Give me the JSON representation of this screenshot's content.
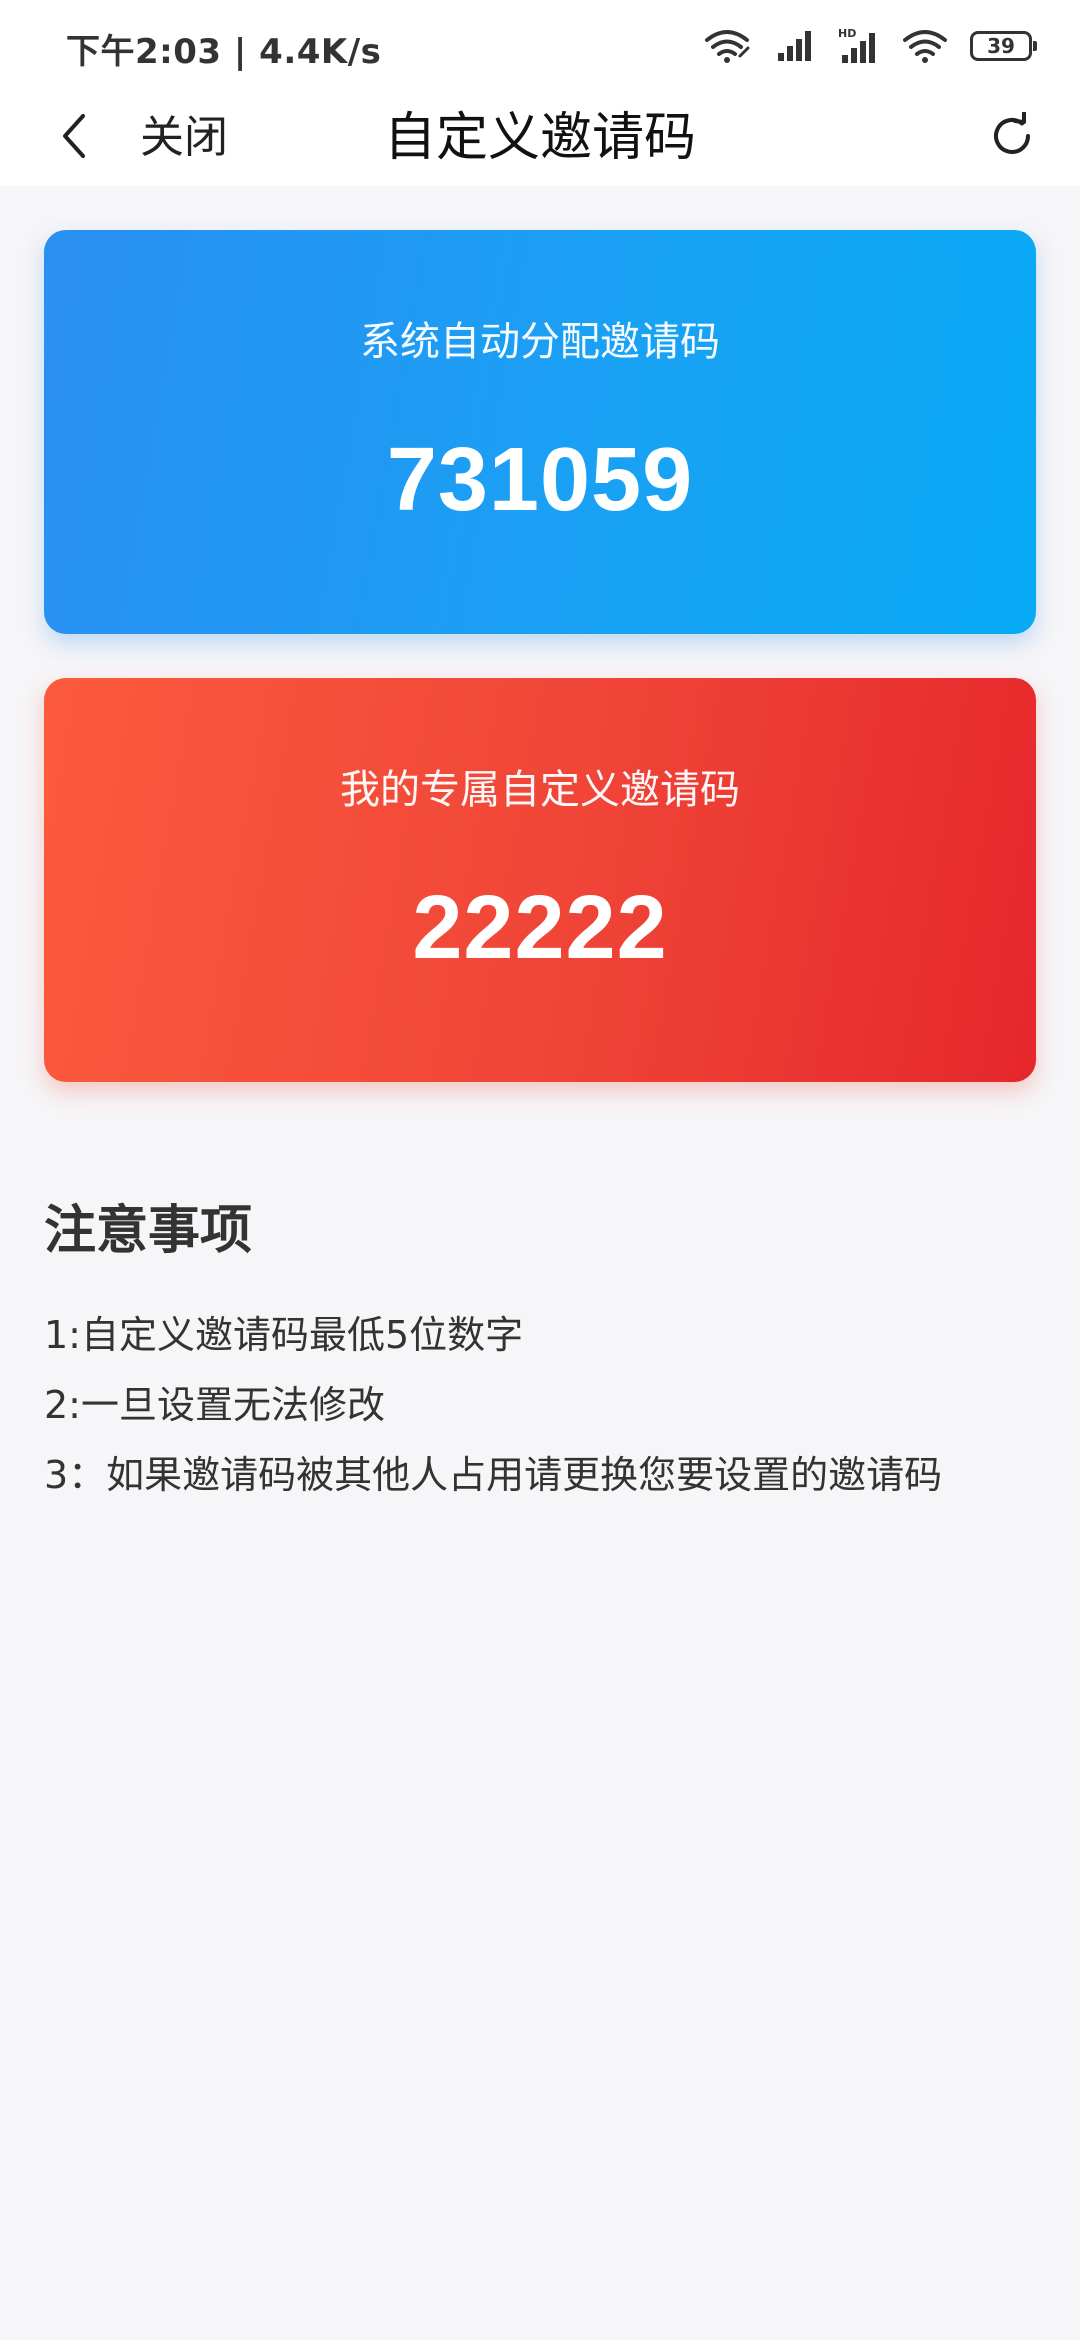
{
  "status_bar": {
    "time": "下午2:03 | 4.4K/s",
    "battery": "39"
  },
  "nav": {
    "close_label": "关闭",
    "title": "自定义邀请码",
    "icons": [
      "chevron-left-icon",
      "refresh-icon"
    ]
  },
  "system_card": {
    "label": "系统自动分配邀请码",
    "code": "731059",
    "color": "#1ea0f4"
  },
  "custom_card": {
    "label": "我的专属自定义邀请码",
    "code": "22222",
    "color": "#ee3c34"
  },
  "notes": {
    "title": "注意事项",
    "items": [
      "1:自定义邀请码最低5位数字",
      "2:一旦设置无法修改",
      "3：如果邀请码被其他人占用请更换您要设置的邀请码"
    ]
  }
}
